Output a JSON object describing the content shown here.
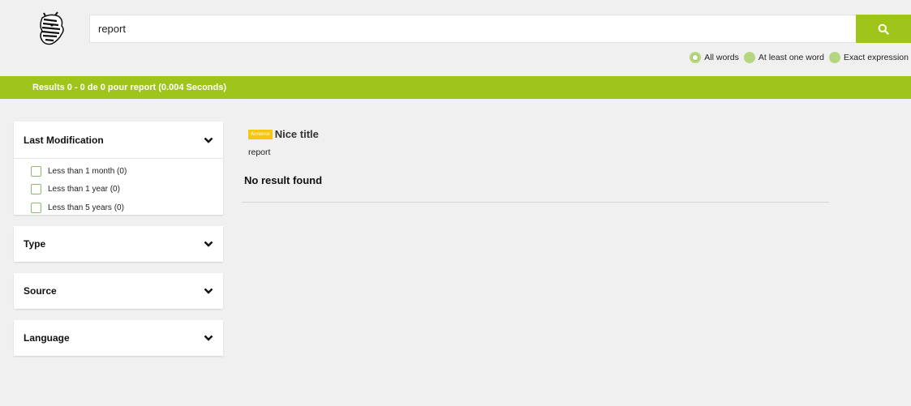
{
  "search": {
    "value": "report",
    "button_icon": "search-icon"
  },
  "modes": [
    {
      "label": "All words",
      "checked": true
    },
    {
      "label": "At least one word",
      "checked": false
    },
    {
      "label": "Exact expression",
      "checked": false
    }
  ],
  "results_bar": {
    "text": "Results 0 - 0 de 0 pour report (0.004 Seconds)"
  },
  "facets": {
    "last_modification": {
      "title": "Last Modification",
      "options": [
        "Less than 1 month (0)",
        "Less than 1 year (0)",
        "Less than 5 years (0)"
      ]
    },
    "type": {
      "title": "Type"
    },
    "source": {
      "title": "Source"
    },
    "language": {
      "title": "Language"
    }
  },
  "result": {
    "badge": "Annonce",
    "title": "Nice title",
    "snippet": "report",
    "empty_message": "No result found"
  },
  "colors": {
    "accent": "#a0c51a",
    "badge": "#f5c60f",
    "background": "#f0f0f0"
  }
}
